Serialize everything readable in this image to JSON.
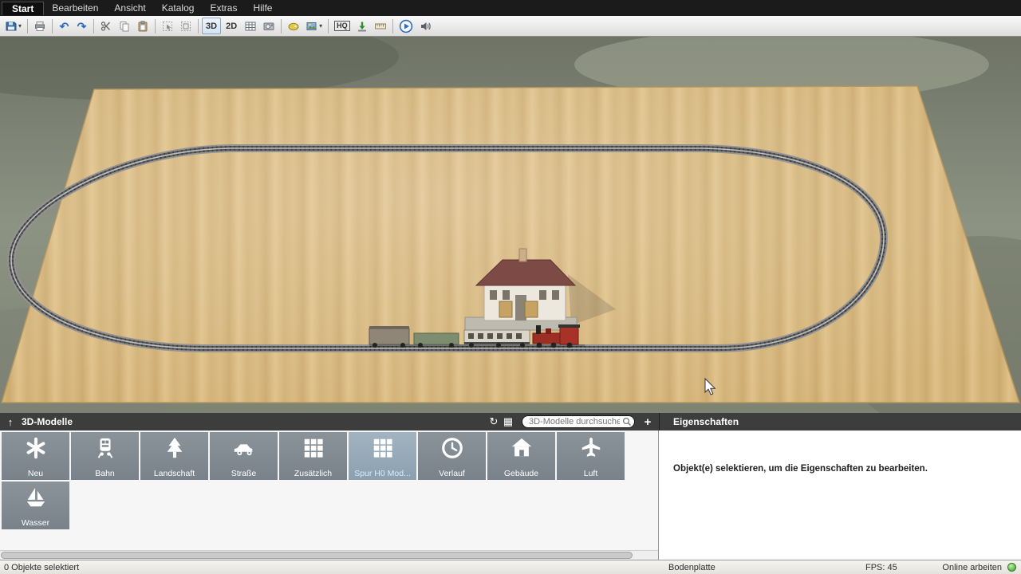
{
  "menu": {
    "items": [
      "Start",
      "Bearbeiten",
      "Ansicht",
      "Katalog",
      "Extras",
      "Hilfe"
    ]
  },
  "toolbar": {
    "view3d": "3D",
    "view2d": "2D",
    "hq": "HQ"
  },
  "models_panel": {
    "title": "3D-Modelle",
    "search_placeholder": "3D-Modelle durchsuchen",
    "add_button": "+",
    "tiles": [
      {
        "label": "Neu",
        "icon": "asterisk-icon"
      },
      {
        "label": "Bahn",
        "icon": "train-icon"
      },
      {
        "label": "Landschaft",
        "icon": "tree-icon"
      },
      {
        "label": "Straße",
        "icon": "car-icon"
      },
      {
        "label": "Zusätzlich",
        "icon": "grid-icon"
      },
      {
        "label": "Spur H0 Mod...",
        "icon": "grid-icon",
        "selected": true
      },
      {
        "label": "Verlauf",
        "icon": "clock-icon"
      },
      {
        "label": "Gebäude",
        "icon": "house-icon"
      },
      {
        "label": "Luft",
        "icon": "plane-icon"
      },
      {
        "label": "Wasser",
        "icon": "sailboat-icon"
      }
    ]
  },
  "properties_panel": {
    "title": "Eigenschaften",
    "empty_message": "Objekt(e) selektieren, um die Eigenschaften zu bearbeiten."
  },
  "statusbar": {
    "selection": "0 Objekte selektiert",
    "object": "Bodenplatte",
    "fps": "FPS: 45",
    "online": "Online arbeiten"
  },
  "colors": {
    "online_indicator": "#3f9a2f",
    "tile": "#828a91",
    "selected_tile": "#93a7b6",
    "accent_blue": "#2e6bbf",
    "board_wood": "#d6b67c"
  }
}
